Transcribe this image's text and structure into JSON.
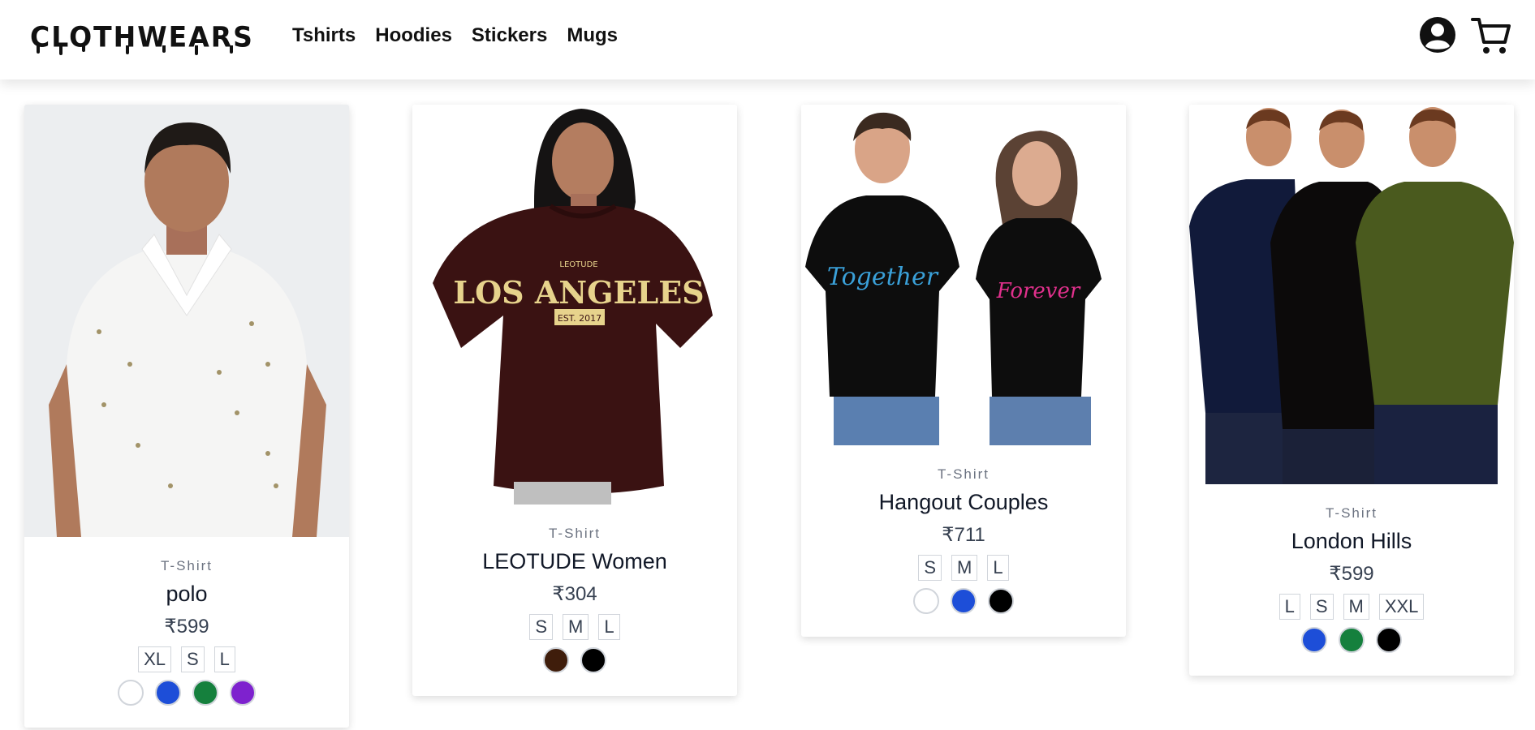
{
  "brand": {
    "logo_text": "CLOTHWEARS"
  },
  "nav": {
    "links": [
      "Tshirts",
      "Hoodies",
      "Stickers",
      "Mugs"
    ],
    "account_icon": "user-circle-icon",
    "cart_icon": "shopping-cart-icon"
  },
  "products": [
    {
      "category": "T-Shirt",
      "title": "polo",
      "price": "₹599",
      "sizes": [
        "XL",
        "S",
        "L"
      ],
      "colors": [
        "#ffffff",
        "#1d4ed8",
        "#15803d",
        "#7e22ce"
      ],
      "image": "man-in-white-polo-shirt"
    },
    {
      "category": "T-Shirt",
      "title": "LEOTUDE Women",
      "price": "₹304",
      "sizes": [
        "S",
        "M",
        "L"
      ],
      "colors": [
        "#3f1d0b",
        "#000000"
      ],
      "image": "woman-in-maroon-oversized-tee",
      "print": {
        "top": "LEOTUDE",
        "main": "LOS ANGELES",
        "badge": "EST. 2017"
      }
    },
    {
      "category": "T-Shirt",
      "title": "Hangout Couples",
      "price": "₹711",
      "sizes": [
        "S",
        "M",
        "L"
      ],
      "colors": [
        "#ffffff",
        "#1d4ed8",
        "#000000"
      ],
      "image": "couple-in-black-tees",
      "print": {
        "left": "Together",
        "right": "Forever"
      }
    },
    {
      "category": "T-Shirt",
      "title": "London Hills",
      "price": "₹599",
      "sizes": [
        "L",
        "S",
        "M",
        "XXL"
      ],
      "colors": [
        "#1d4ed8",
        "#15803d",
        "#000000"
      ],
      "image": "three-men-in-plain-tees"
    }
  ]
}
